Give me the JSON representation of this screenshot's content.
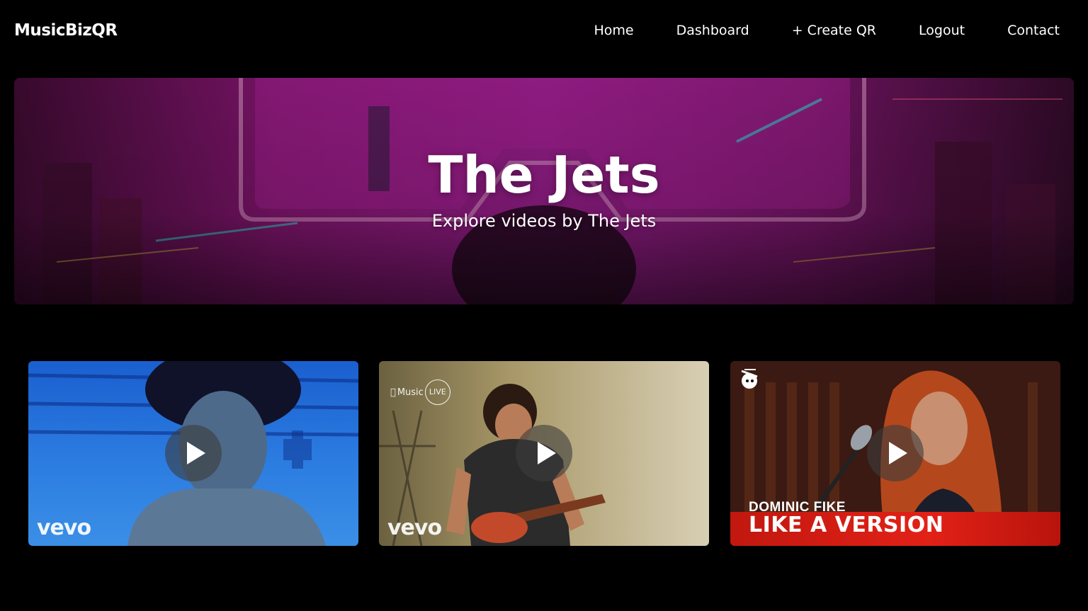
{
  "brand": "MusicBizQR",
  "nav": {
    "home": "Home",
    "dashboard": "Dashboard",
    "create_qr": "+ Create QR",
    "logout": "Logout",
    "contact": "Contact"
  },
  "hero": {
    "title": "The Jets",
    "subtitle": "Explore videos by The Jets"
  },
  "videos": [
    {
      "badge": "vevo",
      "icon": "play-icon"
    },
    {
      "badge": "vevo",
      "top_badge": "Music",
      "top_badge_circle": "LIVE",
      "icon": "play-icon"
    },
    {
      "artist": "DOMINIC FIKE",
      "series": "LIKE A VERSION",
      "icon": "play-icon"
    }
  ],
  "colors": {
    "background": "#000000",
    "hero_magenta": "#8a1a7a",
    "pool_blue": "#1f6fd6",
    "like_a_version_red": "#d41f16"
  }
}
